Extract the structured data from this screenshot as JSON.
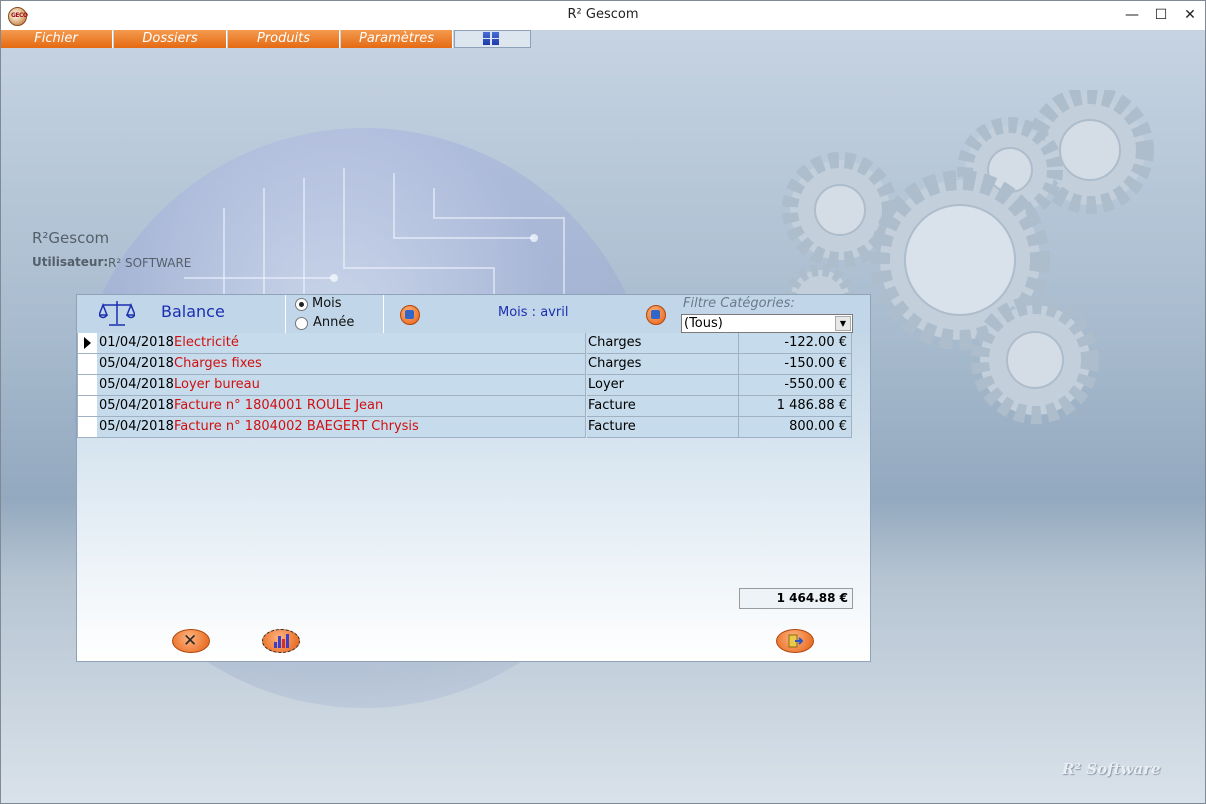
{
  "window": {
    "title": "R² Gescom",
    "minimize": "—",
    "maximize": "☐",
    "close": "✕"
  },
  "menu": [
    {
      "label": "Fichier"
    },
    {
      "label": "Dossiers"
    },
    {
      "label": "Produits"
    },
    {
      "label": "Paramètres"
    }
  ],
  "info": {
    "app_name": "R²Gescom",
    "user_label": "Utilisateur:",
    "user_value": "R² SOFTWARE"
  },
  "signature": "R² Software",
  "dialog": {
    "title": "Balance",
    "period_options": [
      {
        "label": "Mois",
        "selected": true
      },
      {
        "label": "Année",
        "selected": false
      }
    ],
    "period_text": "Mois : avril",
    "filter_label": "Filtre Catégories:",
    "filter_value": "(Tous)",
    "rows": [
      {
        "date": "01/04/2018",
        "libelle": "Electricité",
        "categorie": "Charges",
        "montant": "-122.00 €",
        "current": true
      },
      {
        "date": "05/04/2018",
        "libelle": "Charges fixes",
        "categorie": "Charges",
        "montant": "-150.00 €",
        "current": false
      },
      {
        "date": "05/04/2018",
        "libelle": "Loyer bureau",
        "categorie": "Loyer",
        "montant": "-550.00 €",
        "current": false
      },
      {
        "date": "05/04/2018",
        "libelle": "Facture n° 1804001 ROULE Jean",
        "categorie": "Facture",
        "montant": "1 486.88 €",
        "current": false
      },
      {
        "date": "05/04/2018",
        "libelle": "Facture n° 1804002 BAEGERT Chrysis",
        "categorie": "Facture",
        "montant": "800.00 €",
        "current": false
      }
    ],
    "total": "1 464.88 €"
  },
  "colors": {
    "menu_accent": "#e56a12",
    "title_blue": "#1a2fb0",
    "label_red": "#d01010"
  }
}
